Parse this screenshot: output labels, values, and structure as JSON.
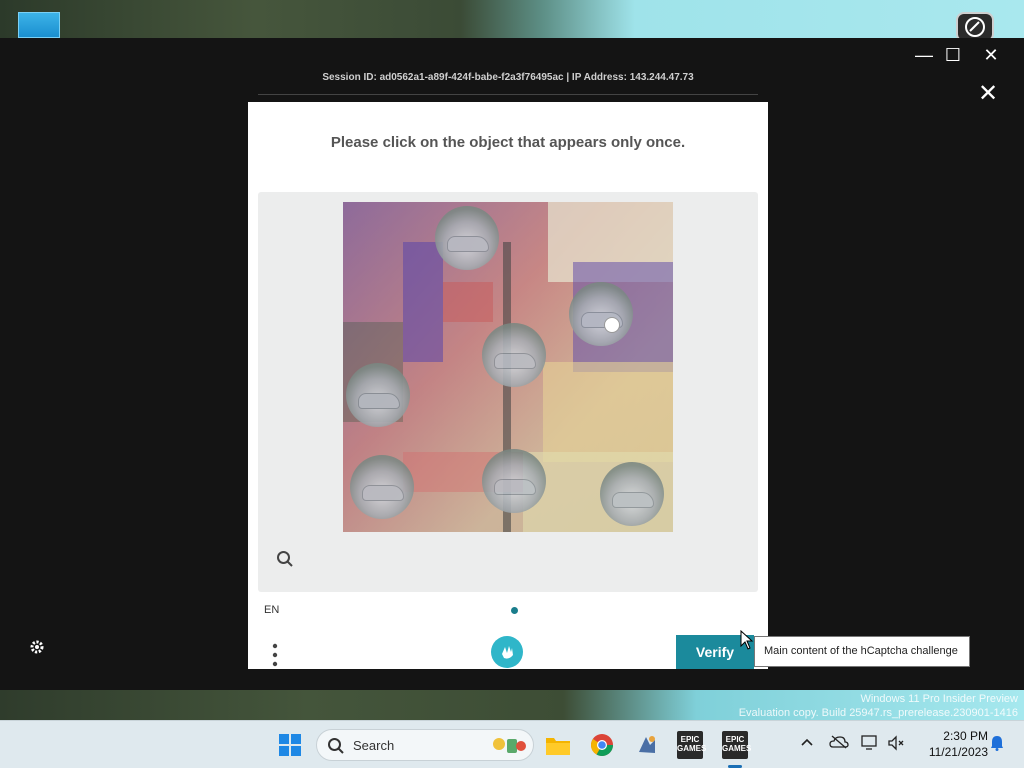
{
  "window": {
    "minimize_glyph": "—",
    "maximize_glyph": "☐",
    "close_glyph": "✕"
  },
  "session": {
    "text": "Session ID: ad0562a1-a89f-424f-babe-f2a3f76495ac | IP Address: 143.244.47.73"
  },
  "dialog": {
    "close_glyph": "✕"
  },
  "captcha": {
    "prompt": "Please click on the object that appears only once.",
    "language": "EN",
    "verify_label": "Verify",
    "tooltip": "Main content of the hCaptcha challenge",
    "accent_color": "#1b8a9c"
  },
  "watermark": {
    "line1": "Windows 11 Pro Insider Preview",
    "line2": "Evaluation copy. Build 25947.rs_prerelease.230901-1416"
  },
  "taskbar": {
    "search_label": "Search",
    "apps": [
      {
        "name": "file-explorer"
      },
      {
        "name": "chrome"
      },
      {
        "name": "app-launcher"
      },
      {
        "name": "epic-games",
        "label": "EPIC GAMES"
      },
      {
        "name": "epic-games-active",
        "label": "EPIC GAMES"
      }
    ],
    "clock_time": "2:30 PM",
    "clock_date": "11/21/2023"
  }
}
